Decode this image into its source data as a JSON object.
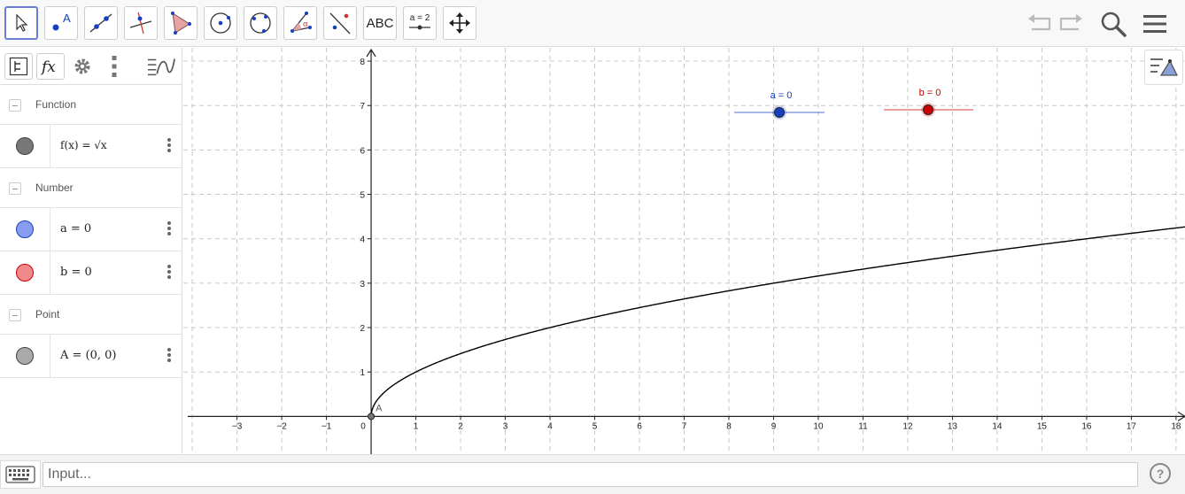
{
  "toolbar": {
    "tools": [
      {
        "name": "move-tool",
        "active": true
      },
      {
        "name": "point-tool",
        "label": "A"
      },
      {
        "name": "line-tool"
      },
      {
        "name": "perpendicular-line-tool"
      },
      {
        "name": "polygon-tool"
      },
      {
        "name": "circle-center-point-tool"
      },
      {
        "name": "circle-three-points-tool"
      },
      {
        "name": "angle-tool",
        "label": "α"
      },
      {
        "name": "reflect-tool"
      },
      {
        "name": "text-tool",
        "label": "ABC"
      },
      {
        "name": "slider-tool",
        "label": "a = 2"
      },
      {
        "name": "move-graphics-view-tool"
      }
    ],
    "right_icons": [
      "undo-icon",
      "redo-icon",
      "search-icon",
      "menu-icon"
    ]
  },
  "algebra": {
    "header_icons": [
      "sort-icon",
      "fx-icon",
      "gear-icon",
      "more-vertical-icon",
      "graph-style-icon"
    ],
    "groups": [
      {
        "label": "Function",
        "items": [
          {
            "text": "f(x) = √x",
            "color": "#777777"
          }
        ]
      },
      {
        "label": "Number",
        "items": [
          {
            "text": "a = 0",
            "color": "#8a9cf0"
          },
          {
            "text": "b = 0",
            "color": "#f08a8a"
          }
        ]
      },
      {
        "label": "Point",
        "items": [
          {
            "text": "A = (0, 0)",
            "color": "#aaaaaa"
          }
        ]
      }
    ]
  },
  "graphics": {
    "x_ticks": [
      "−3",
      "−2",
      "−1",
      "0",
      "1",
      "2",
      "3",
      "4",
      "5",
      "6",
      "7",
      "8",
      "9",
      "10",
      "11",
      "12",
      "13",
      "14",
      "15",
      "16",
      "17",
      "18"
    ],
    "y_ticks": [
      "1",
      "2",
      "3",
      "4",
      "5",
      "6",
      "7",
      "8"
    ],
    "xlim": [
      -4.2,
      18.2
    ],
    "ylim": [
      -0.85,
      8.3
    ],
    "grid": "dashed",
    "function": {
      "label": "f(x) = √x",
      "color": "#000000"
    },
    "point": {
      "label": "A",
      "x": 0,
      "y": 0
    },
    "sliders": [
      {
        "label": "a = 0",
        "value": 0,
        "color": "#1540c0"
      },
      {
        "label": "b = 0",
        "value": 0,
        "color": "#cc0000"
      }
    ]
  },
  "input": {
    "placeholder": "Input..."
  },
  "help": {
    "label": "?"
  },
  "colors": {
    "accent": "#6b7dd6"
  }
}
